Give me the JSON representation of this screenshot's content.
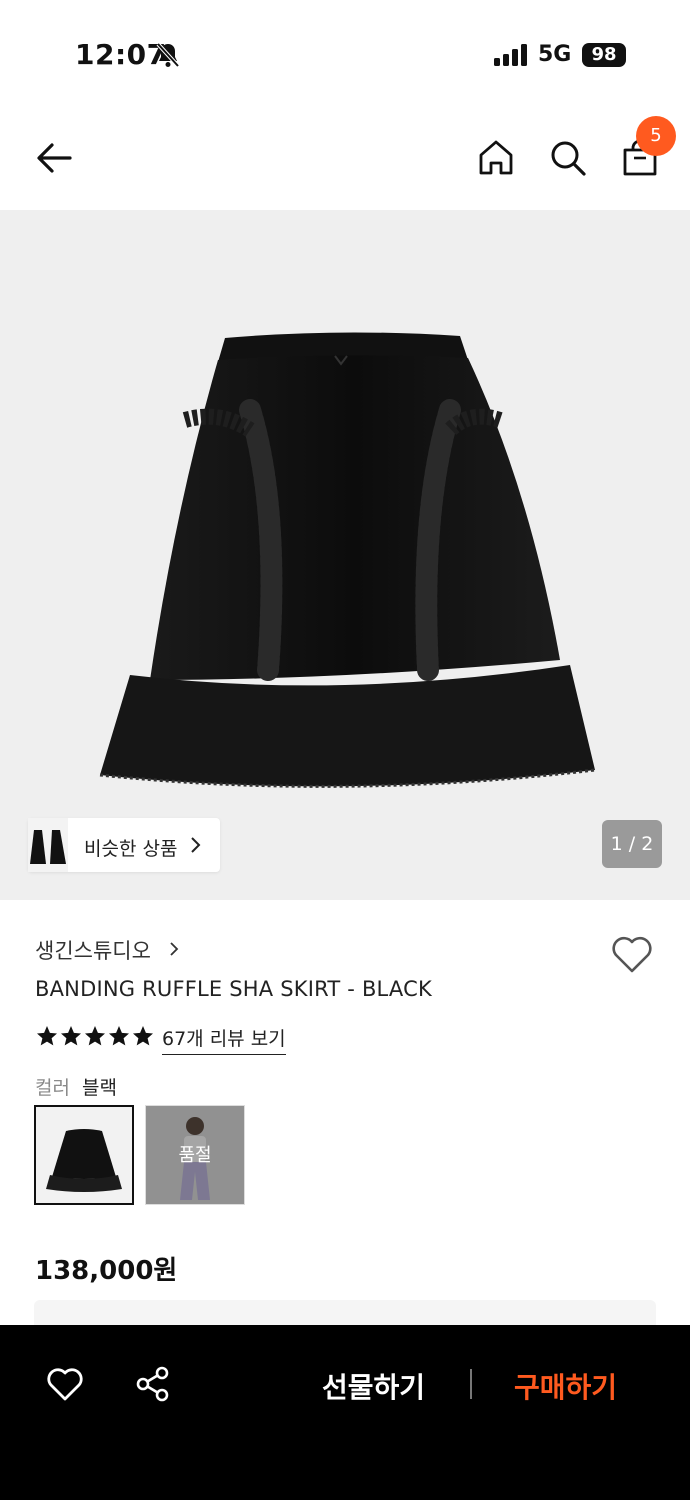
{
  "status_bar": {
    "time": "12:07",
    "network": "5G",
    "battery": "98"
  },
  "header": {
    "cart_count": "5"
  },
  "gallery": {
    "similar_label": "비슷한 상품",
    "pager": "1 / 2"
  },
  "product": {
    "brand": "생긴스튜디오",
    "title": "BANDING RUFFLE SHA SKIRT - BLACK",
    "rating_stars": 5,
    "review_link": "67개 리뷰 보기",
    "color_label": "컬러",
    "color_value": "블랙",
    "swatches": [
      {
        "name": "black-skirt",
        "status": ""
      },
      {
        "name": "lavender-pants",
        "status": "품절"
      }
    ],
    "price": "138,000원"
  },
  "bottom_bar": {
    "gift_label": "선물하기",
    "buy_label": "구매하기",
    "accent_color": "#ff5a1f"
  }
}
